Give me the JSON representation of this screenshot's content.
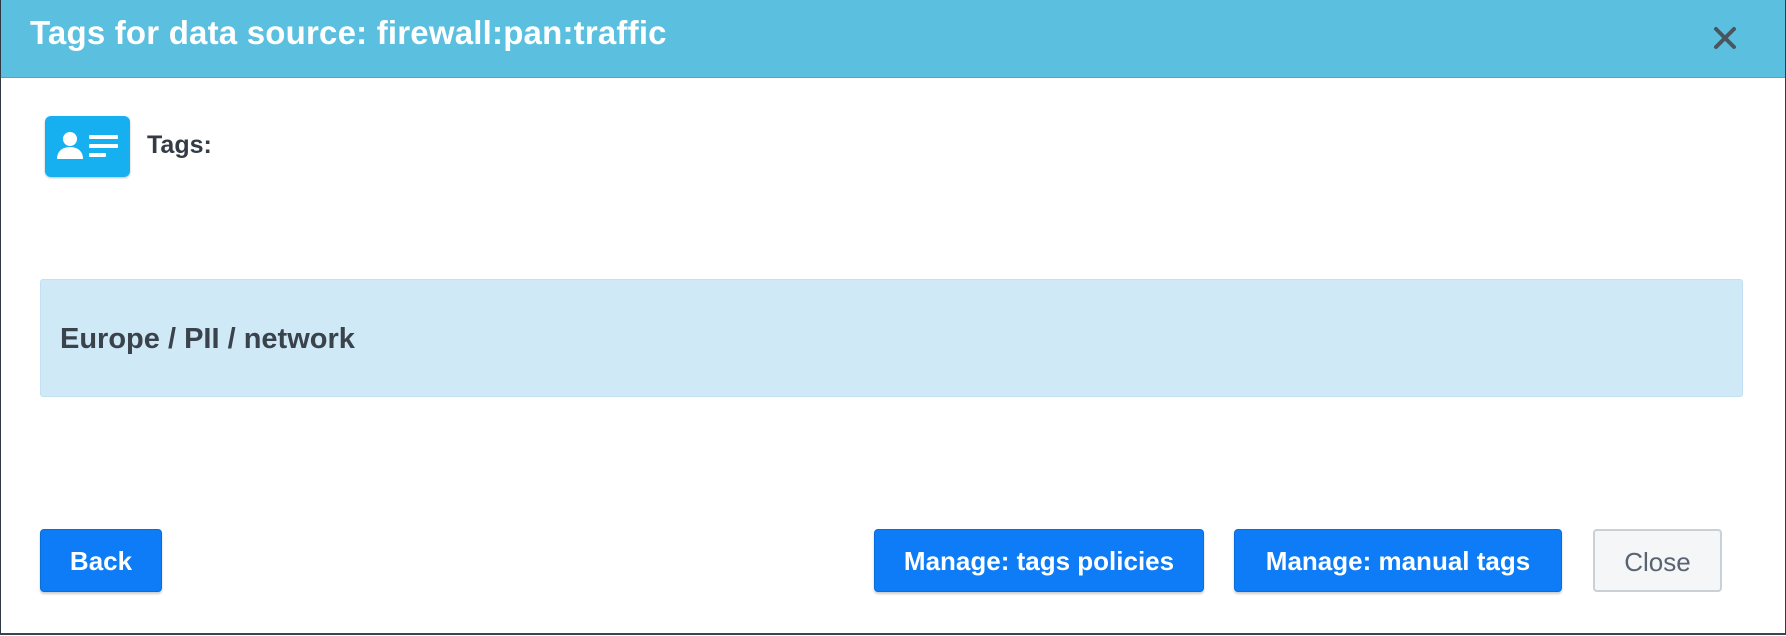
{
  "dialog": {
    "title": "Tags for data source: firewall:pan:traffic",
    "close_icon": "close-icon"
  },
  "tags_section": {
    "icon": "id-card-icon",
    "label": "Tags:",
    "tag_path": "Europe / PII / network"
  },
  "footer": {
    "back_label": "Back",
    "policies_label": "Manage: tags policies",
    "manual_label": "Manage: manual tags",
    "close_label": "Close"
  },
  "colors": {
    "header": "#5bc0df",
    "primary": "#0d7cf6",
    "tag_panel": "#d0e9f7",
    "icon_bg": "#16aff0"
  }
}
